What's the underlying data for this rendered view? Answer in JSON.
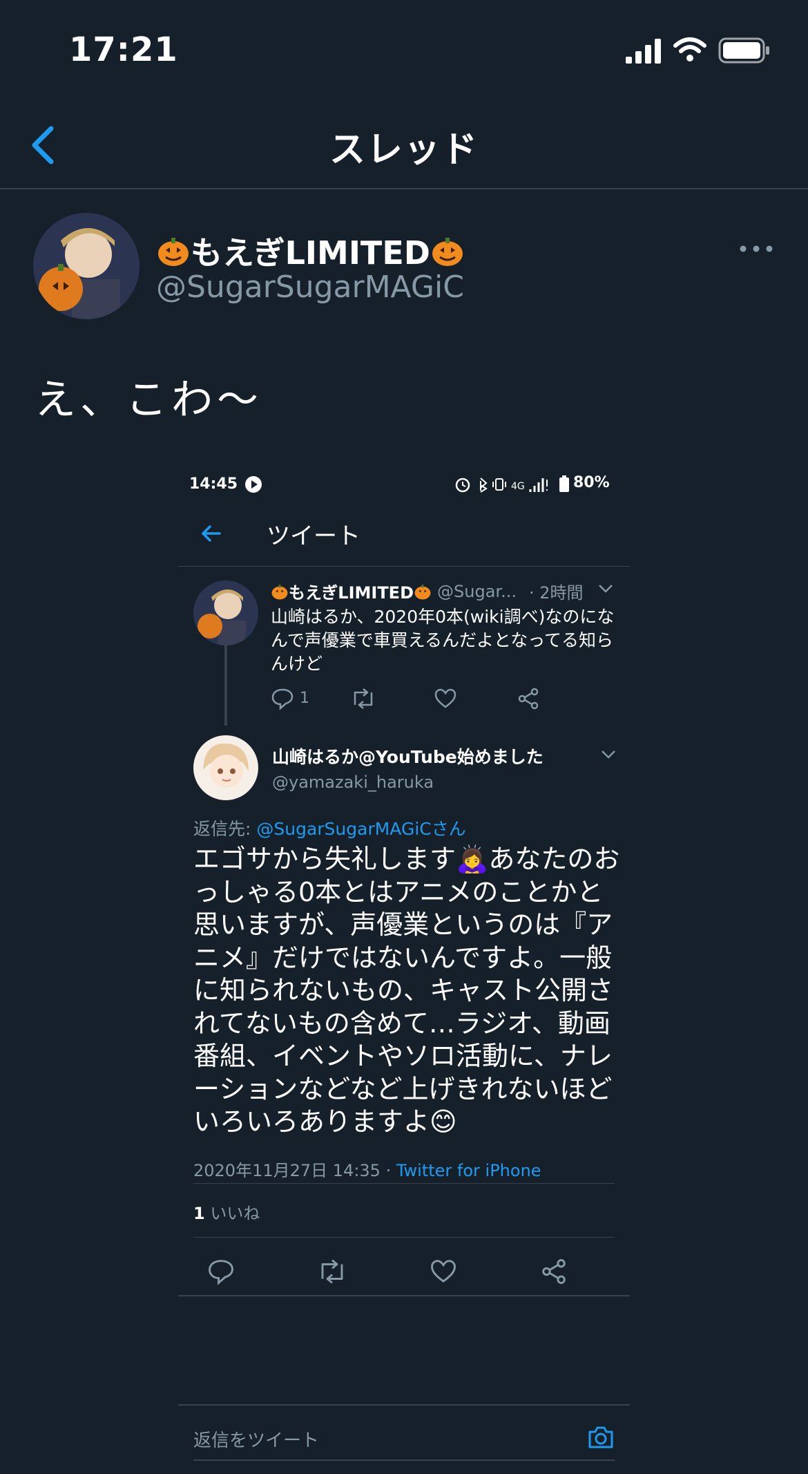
{
  "status_bar": {
    "time": "17:21"
  },
  "nav": {
    "title": "スレッド"
  },
  "tweet": {
    "display_name": "もえぎLIMITED",
    "handle": "@SugarSugarMAGiC",
    "text": "え、こわ〜"
  },
  "embed": {
    "status_time": "14:45",
    "status_battery": "80%",
    "status_network": "4G",
    "title": "ツイート",
    "parent": {
      "name": "もえぎLIMITED",
      "handle": "@Sugar...",
      "time": "· 2時間",
      "text": "山崎はるか、2020年0本(wiki調べ)なのになんで声優業で車買えるんだよとなってる知らんけど",
      "reply_count": "1"
    },
    "reply": {
      "name": "山崎はるか@YouTube始めました",
      "handle": "@yamazaki_haruka",
      "reply_to_label": "返信先: ",
      "reply_to_mention": "@SugarSugarMAGiCさん",
      "text": "エゴサから失礼します🙇‍♀️あなたのおっしゃる0本とはアニメのことかと思いますが、声優業というのは『アニメ』だけではないんですよ。一般に知られないもの、キャスト公開されてないもの含めて…ラジオ、動画番組、イベントやソロ活動に、ナレーションなどなど上げきれないほどいろいろありますよ😊",
      "timestamp": "2020年11月27日 14:35 · ",
      "source": "Twitter for iPhone",
      "like_count": "1",
      "like_label": " いいね"
    }
  },
  "composer": {
    "placeholder": "返信をツイート"
  },
  "colors": {
    "background": "#15202b",
    "accent": "#1d9bf0",
    "muted": "#8899a6",
    "divider": "#38444d"
  }
}
